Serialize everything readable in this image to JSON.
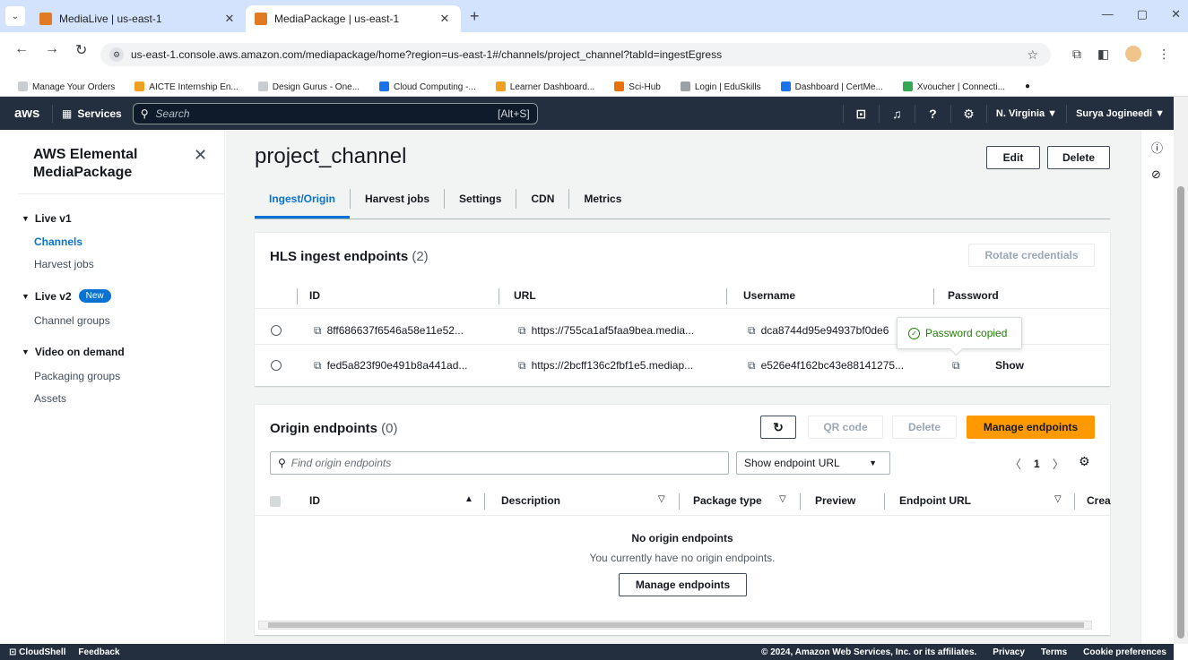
{
  "browser": {
    "tabs": [
      {
        "title": "MediaLive | us-east-1",
        "active": false
      },
      {
        "title": "MediaPackage | us-east-1",
        "active": true
      }
    ],
    "url": "us-east-1.console.aws.amazon.com/mediapackage/home?region=us-east-1#/channels/project_channel?tabId=ingestEgress",
    "bookmarks": [
      "Manage Your Orders",
      "AICTE Internship En...",
      "Design Gurus - One...",
      "Cloud Computing -...",
      "Learner Dashboard...",
      "Sci-Hub",
      "Login | EduSkills",
      "Dashboard | CertMe...",
      "Xvoucher | Connecti..."
    ]
  },
  "awsnav": {
    "logo": "aws",
    "services": "Services",
    "search_placeholder": "Search",
    "search_shortcut": "[Alt+S]",
    "region": "N. Virginia ▼",
    "user": "Surya Jogineedi ▼"
  },
  "sidebar": {
    "title": "AWS Elemental MediaPackage",
    "sections": [
      {
        "label": "Live v1",
        "links": [
          {
            "label": "Channels",
            "active": true
          },
          {
            "label": "Harvest jobs",
            "active": false
          }
        ]
      },
      {
        "label": "Live v2",
        "badge": "New",
        "links": [
          {
            "label": "Channel groups",
            "active": false
          }
        ]
      },
      {
        "label": "Video on demand",
        "links": [
          {
            "label": "Packaging groups",
            "active": false
          },
          {
            "label": "Assets",
            "active": false
          }
        ]
      }
    ]
  },
  "main": {
    "title": "project_channel",
    "edit": "Edit",
    "delete": "Delete",
    "tabs": [
      "Ingest/Origin",
      "Harvest jobs",
      "Settings",
      "CDN",
      "Metrics"
    ],
    "hls": {
      "title": "HLS ingest endpoints",
      "count": "(2)",
      "rotate": "Rotate credentials",
      "columns": [
        "ID",
        "URL",
        "Username",
        "Password"
      ],
      "rows": [
        {
          "id": "8ff686637f6546a58e11e52...",
          "url": "https://755ca1af5faa9bea.media...",
          "username": "dca8744d95e94937bf0de6",
          "password": ""
        },
        {
          "id": "fed5a823f90e491b8a441ad...",
          "url": "https://2bcff136c2fbf1e5.mediap...",
          "username": "e526e4f162bc43e88141275...",
          "password": "Show"
        }
      ],
      "toast": "Password copied"
    },
    "origin": {
      "title": "Origin endpoints",
      "count": "(0)",
      "qr": "QR code",
      "delete": "Delete",
      "manage": "Manage endpoints",
      "filter_placeholder": "Find origin endpoints",
      "select_value": "Show endpoint URL",
      "page": "1",
      "columns": [
        "ID",
        "Description",
        "Package type",
        "Preview",
        "Endpoint URL",
        "Crea"
      ],
      "empty_title": "No origin endpoints",
      "empty_desc": "You currently have no origin endpoints.",
      "empty_button": "Manage endpoints"
    }
  },
  "footer": {
    "cloudshell": "CloudShell",
    "feedback": "Feedback",
    "copyright": "© 2024, Amazon Web Services, Inc. or its affiliates.",
    "privacy": "Privacy",
    "terms": "Terms",
    "cookies": "Cookie preferences"
  }
}
